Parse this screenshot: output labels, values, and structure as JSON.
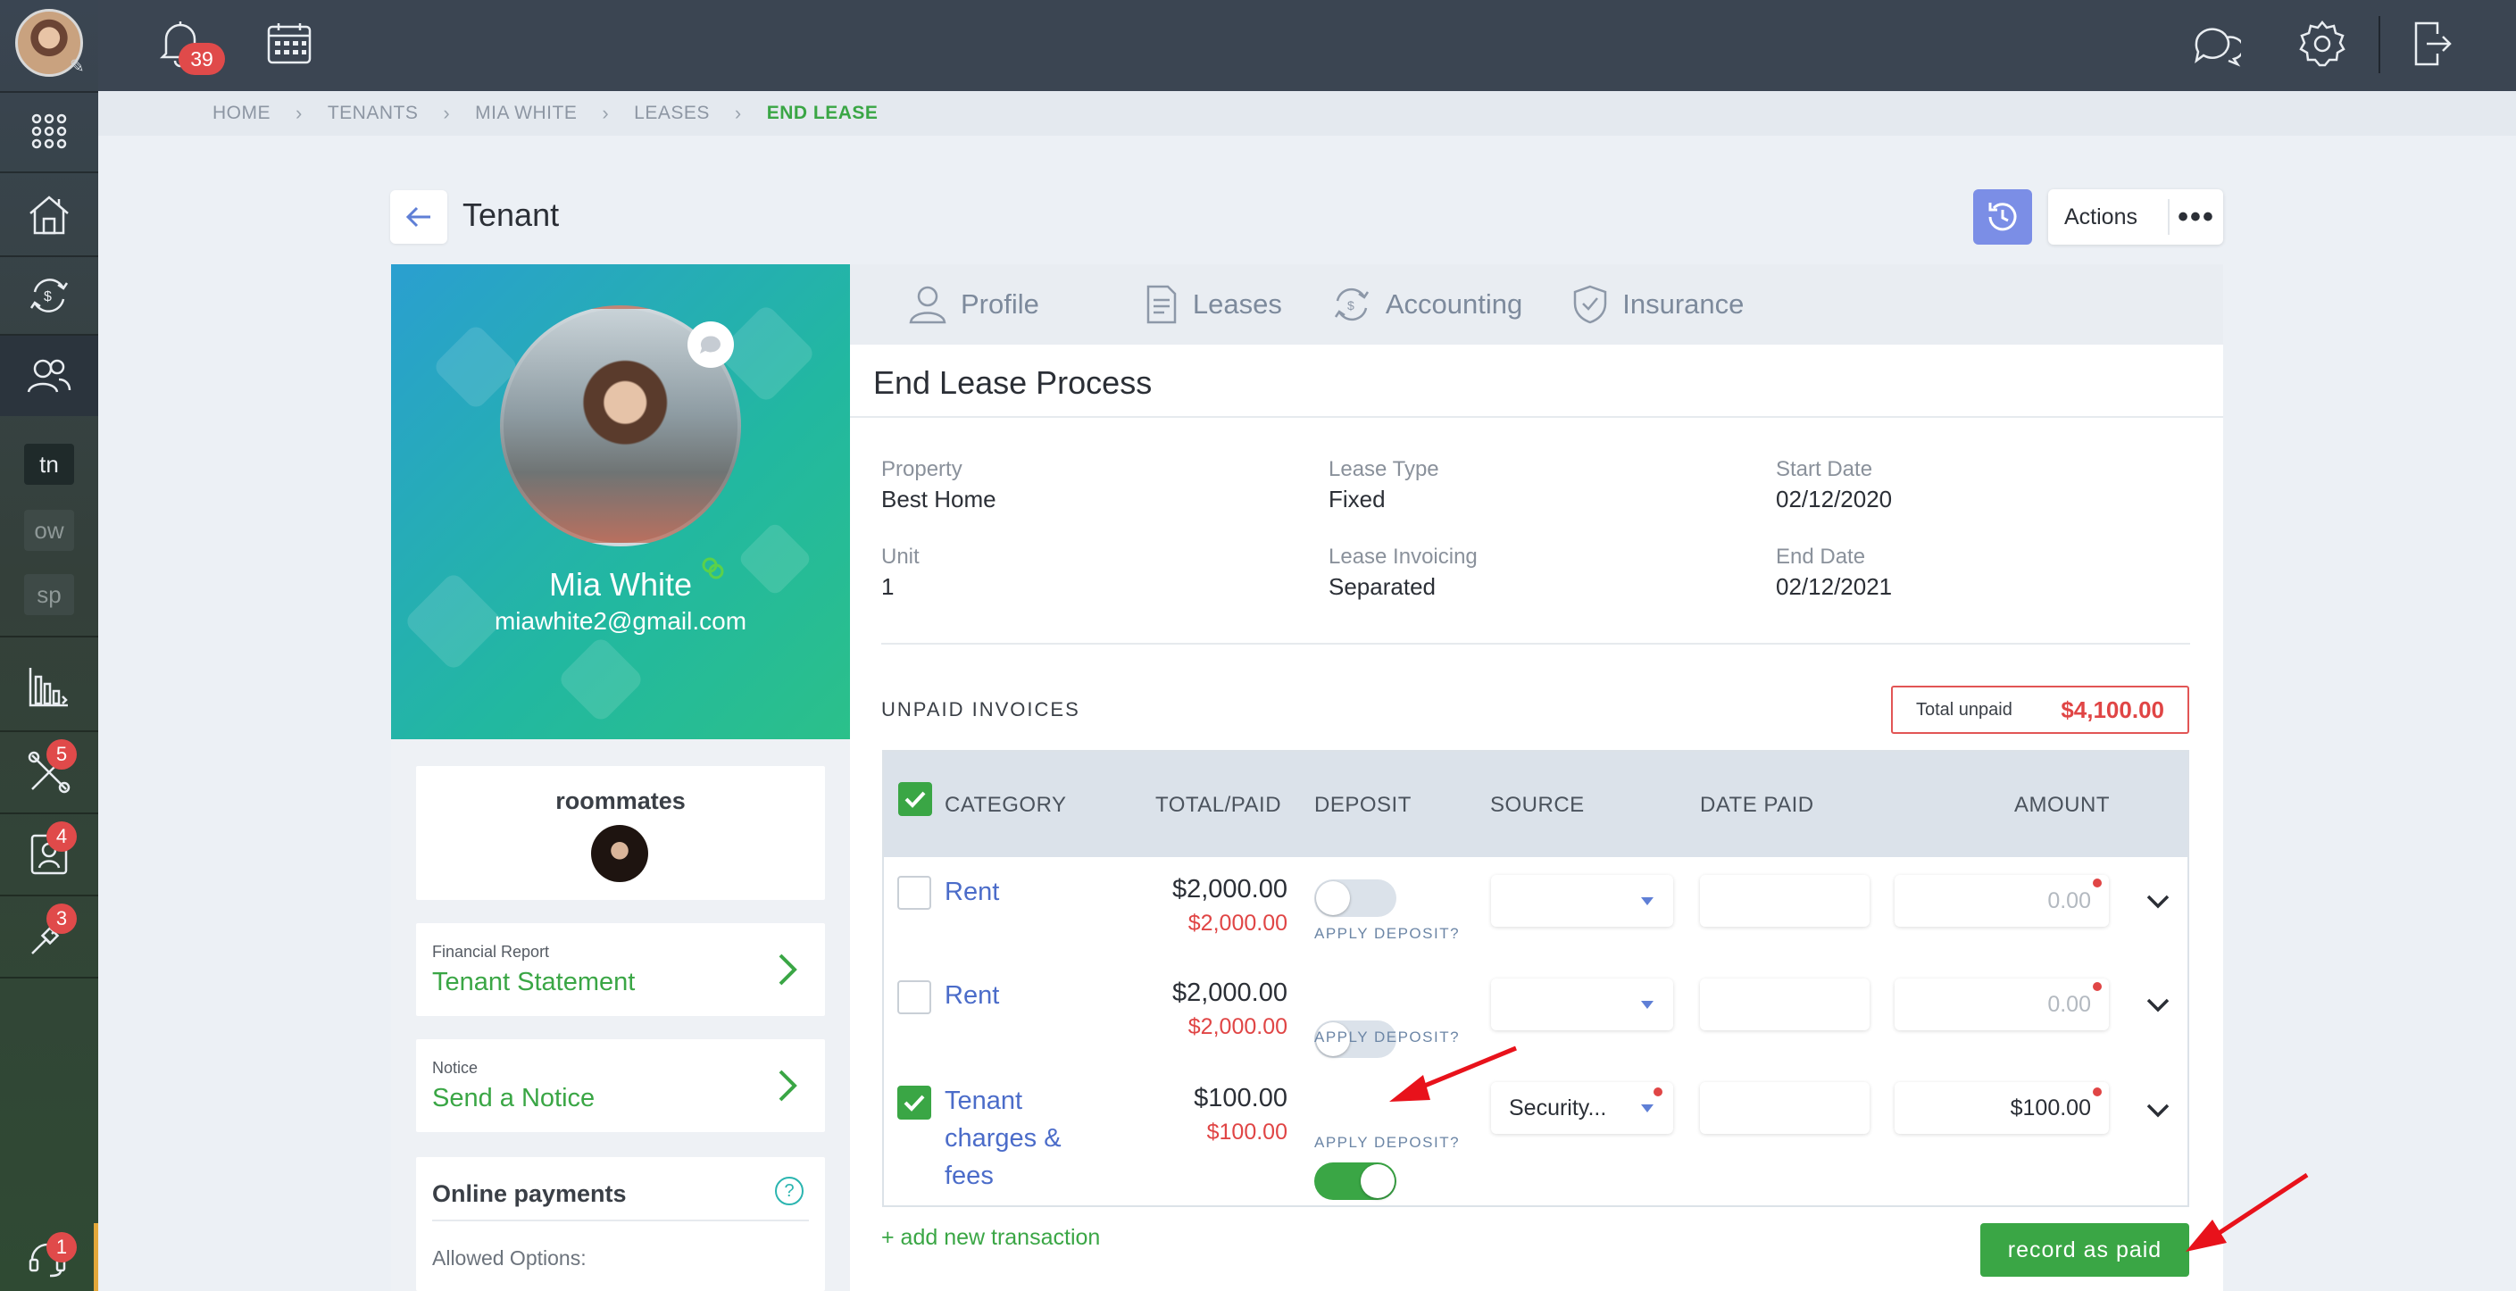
{
  "rail": {
    "notifications_badge": "",
    "tn": "tn",
    "ow": "ow",
    "sp": "sp",
    "maintenance_badge": "5",
    "contacts_badge": "4",
    "tasks_badge": "3",
    "support_badge": "1"
  },
  "topbar": {
    "notifications_count": "39"
  },
  "breadcrumb": [
    "HOME",
    "TENANTS",
    "MIA WHITE",
    "LEASES",
    "END LEASE"
  ],
  "header": {
    "title": "Tenant",
    "actions_label": "Actions",
    "more": "•••"
  },
  "profile": {
    "name": "Mia White",
    "email": "miawhite2@gmail.com"
  },
  "roommates": {
    "title": "roommates"
  },
  "financial_report": {
    "caption": "Financial Report",
    "link": "Tenant Statement"
  },
  "notice": {
    "caption": "Notice",
    "link": "Send a Notice"
  },
  "online_payments": {
    "title": "Online payments",
    "help": "?",
    "allowed": "Allowed Options:"
  },
  "tabs": [
    "Profile",
    "Leases",
    "Accounting",
    "Insurance"
  ],
  "process": {
    "title": "End Lease Process"
  },
  "lease": {
    "property_label": "Property",
    "property": "Best Home",
    "lease_type_label": "Lease Type",
    "lease_type": "Fixed",
    "start_label": "Start Date",
    "start": "02/12/2020",
    "unit_label": "Unit",
    "unit": "1",
    "invoicing_label": "Lease Invoicing",
    "invoicing": "Separated",
    "end_label": "End Date",
    "end": "02/12/2021"
  },
  "unpaid": {
    "title": "UNPAID INVOICES",
    "total_label": "Total unpaid",
    "total": "$4,100.00"
  },
  "columns": [
    "CATEGORY",
    "TOTAL/PAID",
    "DEPOSIT",
    "SOURCE",
    "DATE PAID",
    "AMOUNT"
  ],
  "rows": [
    {
      "checked": false,
      "category": "Rent",
      "total": "$2,000.00",
      "paid": "$2,000.00",
      "deposit_on": false,
      "apply": "APPLY DEPOSIT?",
      "source": "",
      "date_paid": "",
      "amount": "0.00"
    },
    {
      "checked": false,
      "category": "Rent",
      "total": "$2,000.00",
      "paid": "$2,000.00",
      "deposit_on": false,
      "apply": "APPLY DEPOSIT?",
      "source": "",
      "date_paid": "",
      "amount": "0.00"
    },
    {
      "checked": true,
      "category": "Tenant charges & fees",
      "total": "$100.00",
      "paid": "$100.00",
      "deposit_on": true,
      "apply": "APPLY DEPOSIT?",
      "source": "Security...",
      "date_paid": "",
      "amount": "$100.00"
    }
  ],
  "footer": {
    "add": "+ add new transaction",
    "record": "record as paid"
  },
  "colors": {
    "accent_green": "#3aa645",
    "alert_red": "#e04545",
    "link_blue": "#4b6cc9"
  }
}
